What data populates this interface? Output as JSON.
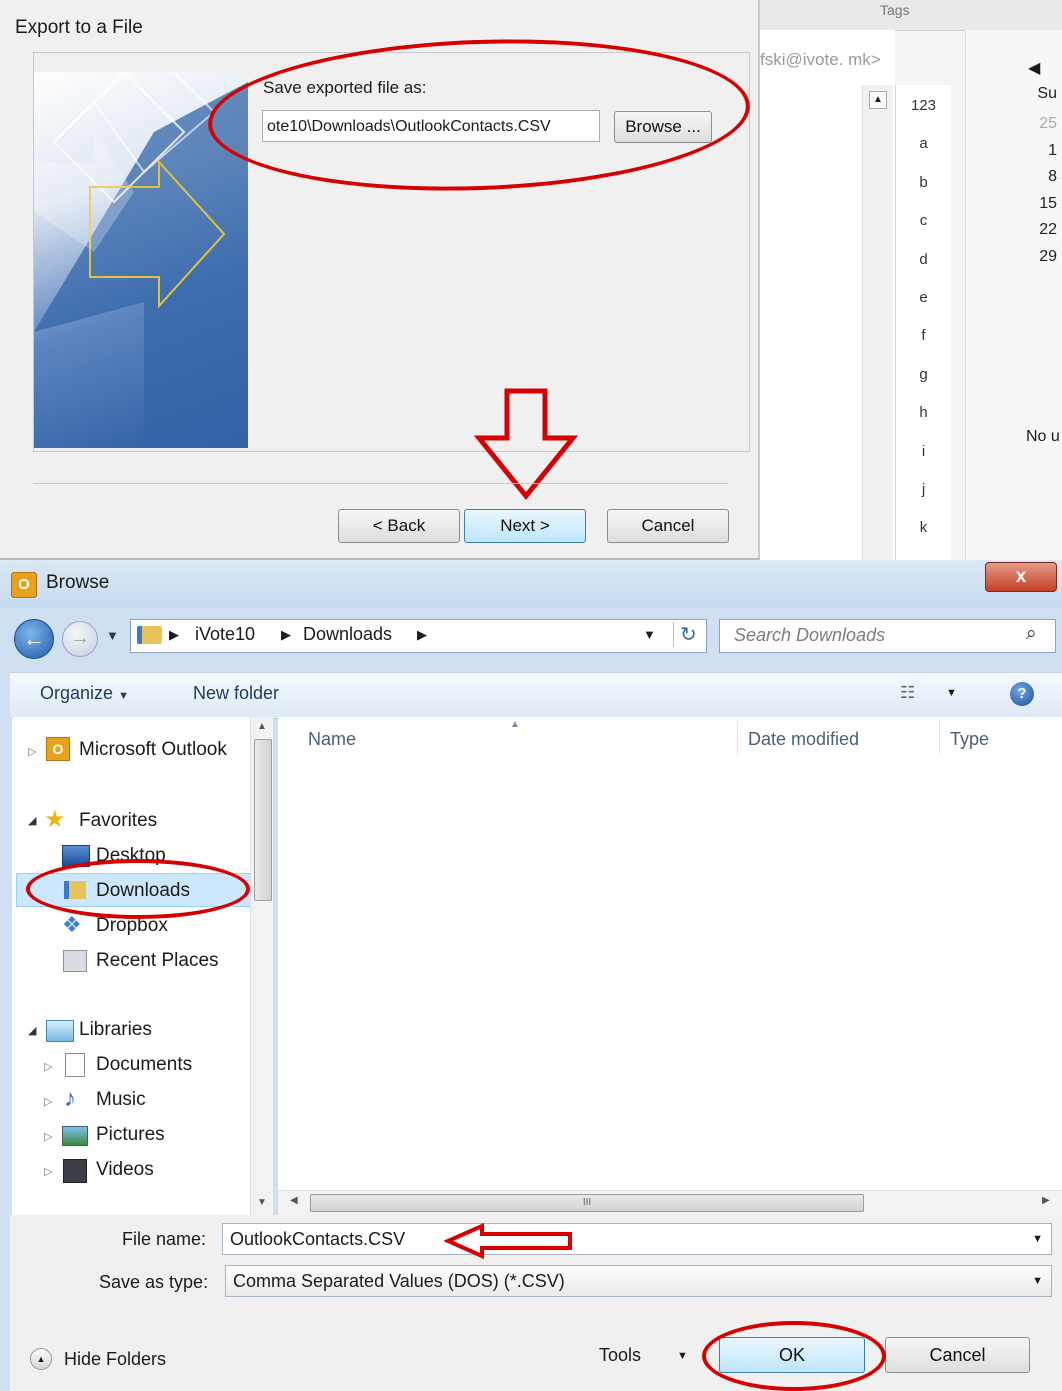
{
  "background": {
    "email_hint": "fski@ivote. mk>",
    "tags_label": "Tags",
    "alphabet": [
      "123",
      "a",
      "b",
      "c",
      "d",
      "e",
      "f",
      "g",
      "h",
      "i",
      "j",
      "k"
    ],
    "calendar": {
      "day_header": "Su",
      "days": [
        "25",
        "1",
        "8",
        "15",
        "22",
        "29"
      ],
      "note": "No u"
    }
  },
  "export_dialog": {
    "title": "Export to a File",
    "save_label": "Save exported file as:",
    "path_value": "ote10\\Downloads\\OutlookContacts.CSV",
    "browse_label": "Browse ...",
    "back_label": "< Back",
    "next_label": "Next >",
    "cancel_label": "Cancel"
  },
  "browse_dialog": {
    "title": "Browse",
    "close_glyph": "x",
    "breadcrumb": [
      "iVote10",
      "Downloads"
    ],
    "search_placeholder": "Search Downloads",
    "toolbar": {
      "organize": "Organize",
      "new_folder": "New folder"
    },
    "nav": {
      "outlook": "Microsoft Outlook",
      "favorites": "Favorites",
      "favorites_items": [
        "Desktop",
        "Downloads",
        "Dropbox",
        "Recent Places"
      ],
      "libraries": "Libraries",
      "libraries_items": [
        "Documents",
        "Music",
        "Pictures",
        "Videos"
      ]
    },
    "columns": [
      "Name",
      "Date modified",
      "Type"
    ],
    "file_name_label": "File name:",
    "file_name_value": "OutlookContacts.CSV",
    "save_type_label": "Save as type:",
    "save_type_value": "Comma Separated Values (DOS) (*.CSV)",
    "hide_folders": "Hide Folders",
    "tools": "Tools",
    "ok": "OK",
    "cancel": "Cancel",
    "scroll_grip": "III"
  },
  "colors": {
    "annotation_red": "#d60000",
    "selection_blue": "#cce8ff"
  }
}
